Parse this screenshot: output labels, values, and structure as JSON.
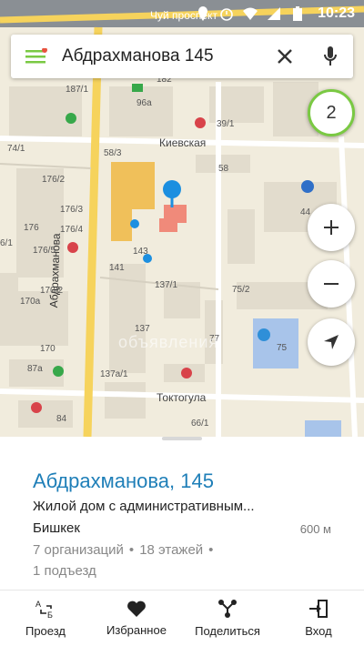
{
  "statusbar": {
    "time": "10:23"
  },
  "search": {
    "value": "Абдрахманова 145",
    "result_count": "2"
  },
  "map": {
    "streets": {
      "top": "Чуй проспект",
      "kievskaya": "Киевская",
      "toktogula": "Токтогула",
      "abdrakhmanova": "Абдрахманова"
    },
    "building_labels": [
      "96а",
      "182",
      "187/1",
      "39/1",
      "58/3",
      "58",
      "74/1",
      "176/2",
      "176/3",
      "176/4",
      "176",
      "176/5",
      "6/1",
      "170/2",
      "170а",
      "170",
      "87а",
      "141",
      "143",
      "137/1",
      "137",
      "137а/1",
      "77",
      "75/2",
      "75",
      "44",
      "84",
      "66/1"
    ],
    "watermark": "объявления"
  },
  "place": {
    "title": "Абдрахманова, 145",
    "description": "Жилой дом с административным...",
    "city": "Бишкек",
    "distance": "600 м",
    "organizations": "7 организаций",
    "floors": "18 этажей",
    "entrances": "1 подъезд"
  },
  "actions": [
    {
      "label": "Проезд",
      "icon": "route-icon"
    },
    {
      "label": "Избранное",
      "icon": "heart-icon"
    },
    {
      "label": "Поделиться",
      "icon": "share-icon"
    },
    {
      "label": "Вход",
      "icon": "entrance-icon"
    }
  ],
  "colors": {
    "accent": "#1f7fb8",
    "menu_green": "#7ac943",
    "road_yellow": "#f6d35c"
  }
}
